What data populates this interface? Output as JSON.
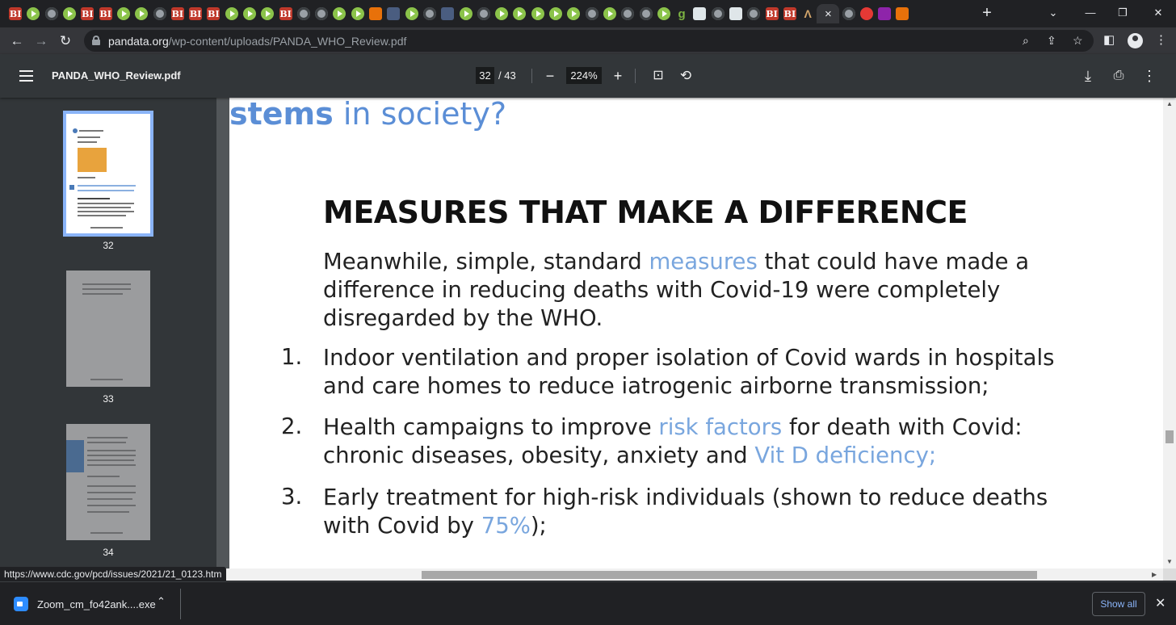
{
  "browser": {
    "tab_icons": [
      "bi",
      "play",
      "globe",
      "play",
      "bi",
      "bi",
      "play",
      "play",
      "globe",
      "bi",
      "bi",
      "bi",
      "play",
      "play",
      "play",
      "bi",
      "globe",
      "globe",
      "play",
      "play",
      "orange",
      "sub",
      "play",
      "globe",
      "sub",
      "play",
      "globe",
      "play",
      "play",
      "play",
      "play",
      "play",
      "globe",
      "play",
      "globe",
      "globe",
      "play",
      "g",
      "grid",
      "globe",
      "grid",
      "globe",
      "bi",
      "bi",
      "arch"
    ],
    "active_tab_close": "×",
    "after_tab_icons": [
      "globe",
      "red",
      "mail",
      "orange"
    ],
    "new_tab": "+",
    "window_controls": {
      "minimize": "—",
      "restore": "❐",
      "close": "✕",
      "dropdown": "⌄"
    },
    "url_host": "pandata.org",
    "url_path": "/wp-content/uploads/PANDA_WHO_Review.pdf"
  },
  "pdf_toolbar": {
    "filename": "PANDA_WHO_Review.pdf",
    "current_page": "32",
    "total_pages": "/ 43",
    "zoom": "224%"
  },
  "sidebar": {
    "thumbnails": [
      {
        "page": "32",
        "selected": true
      },
      {
        "page": "33",
        "selected": false
      },
      {
        "page": "34",
        "selected": false
      }
    ]
  },
  "document": {
    "cut_heading_bold": "stems",
    "cut_heading_rest": " in society?",
    "heading": "MEASURES THAT MAKE A DIFFERENCE",
    "para_before": "Meanwhile, simple, standard ",
    "para_link": "measures",
    "para_after": " that could have made a difference in reducing deaths with Covid-19 were completely disregarded by the WHO.",
    "items": [
      {
        "num": "1.",
        "text": "Indoor ventilation and proper isolation of Covid wards in hospitals and care homes to reduce iatrogenic airborne transmission",
        "end": ";"
      },
      {
        "num": "2.",
        "text_a": "Health campaigns to improve ",
        "link_a": "risk factors",
        "text_b": " for death with Covid: chronic diseases, obesity, anxiety and ",
        "link_b": "Vit D deficiency",
        "end": ";"
      },
      {
        "num": "3.",
        "text": "Early treatment for high-risk individuals (shown to reduce deaths with Covid by ",
        "link": "75%",
        "end": ");"
      }
    ]
  },
  "status_url": "https://www.cdc.gov/pcd/issues/2021/21_0123.htm",
  "downloads": {
    "filename": "Zoom_cm_fo42ank....exe",
    "show_all": "Show all"
  }
}
